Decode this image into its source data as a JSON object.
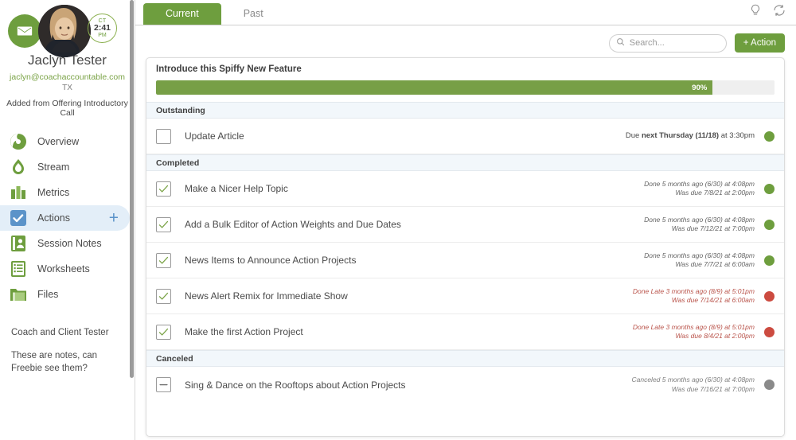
{
  "sidebar": {
    "client": {
      "name": "Jaclyn Tester",
      "email": "jaclyn@coachaccountable.com",
      "state": "TX",
      "added_from": "Added from Offering Introductory Call",
      "clock": {
        "timezone": "CT",
        "time": "2:41",
        "ampm": "PM"
      }
    },
    "nav": [
      {
        "label": "Overview",
        "icon": "overview-icon",
        "active": false
      },
      {
        "label": "Stream",
        "icon": "stream-icon",
        "active": false
      },
      {
        "label": "Metrics",
        "icon": "metrics-icon",
        "active": false
      },
      {
        "label": "Actions",
        "icon": "actions-icon",
        "active": true,
        "plus": "+"
      },
      {
        "label": "Session Notes",
        "icon": "session-notes-icon",
        "active": false
      },
      {
        "label": "Worksheets",
        "icon": "worksheets-icon",
        "active": false
      },
      {
        "label": "Files",
        "icon": "files-icon",
        "active": false
      }
    ],
    "notes": {
      "line1": "Coach and Client Tester",
      "line2": "These are notes, can Freebie see them?"
    }
  },
  "header": {
    "tabs": [
      {
        "label": "Current",
        "active": true
      },
      {
        "label": "Past",
        "active": false
      }
    ],
    "icons": [
      {
        "name": "lightbulb-icon"
      },
      {
        "name": "refresh-icon"
      }
    ]
  },
  "toolbar": {
    "search_placeholder": "Search...",
    "search_value": "",
    "add_action_label": "+ Action"
  },
  "project": {
    "title": "Introduce this Spiffy New Feature",
    "progress_percent": 90,
    "progress_label": "90%"
  },
  "groups": [
    {
      "label": "Outstanding",
      "tasks": [
        {
          "title": "Update Article",
          "state": "open",
          "meta_kind": "due",
          "meta_line1_prefix": "Due ",
          "meta_line1_bold": "next Thursday (11/18)",
          "meta_line1_suffix": " at 3:30pm",
          "meta_line2": "",
          "dot": "green"
        }
      ]
    },
    {
      "label": "Completed",
      "tasks": [
        {
          "title": "Make a Nicer Help Topic",
          "state": "checked",
          "meta_kind": "done",
          "meta_line1": "Done 5 months ago (6/30) at 4:08pm",
          "meta_line2": "Was due 7/8/21 at 2:00pm",
          "dot": "green"
        },
        {
          "title": "Add a Bulk Editor of Action Weights and Due Dates",
          "state": "checked",
          "meta_kind": "done",
          "meta_line1": "Done 5 months ago (6/30) at 4:08pm",
          "meta_line2": "Was due 7/12/21 at 7:00pm",
          "dot": "green"
        },
        {
          "title": "News Items to Announce Action Projects",
          "state": "checked",
          "meta_kind": "done",
          "meta_line1": "Done 5 months ago (6/30) at 4:08pm",
          "meta_line2": "Was due 7/7/21 at 6:00am",
          "dot": "green"
        },
        {
          "title": "News Alert Remix for Immediate Show",
          "state": "checked",
          "meta_kind": "late",
          "meta_line1": "Done Late 3 months ago (8/9) at 5:01pm",
          "meta_line2": "Was due 7/14/21 at 6:00am",
          "dot": "red"
        },
        {
          "title": "Make the first Action Project",
          "state": "checked",
          "meta_kind": "late",
          "meta_line1": "Done Late 3 months ago (8/9) at 5:01pm",
          "meta_line2": "Was due 8/4/21 at 2:00pm",
          "dot": "red"
        }
      ]
    },
    {
      "label": "Canceled",
      "tasks": [
        {
          "title": "Sing & Dance on the Rooftops about Action Projects",
          "state": "canceled",
          "meta_kind": "canceled",
          "meta_line1": "Canceled 5 months ago (6/30) at 4:08pm",
          "meta_line2": "Was due 7/16/21 at 7:00pm",
          "dot": "gray"
        }
      ]
    }
  ],
  "colors": {
    "brand_green": "#6e9e3e",
    "progress_green": "#779f46",
    "accent_blue": "#5b93c9",
    "late_red": "#cc4b40",
    "canceled_gray": "#8a8a8a"
  }
}
